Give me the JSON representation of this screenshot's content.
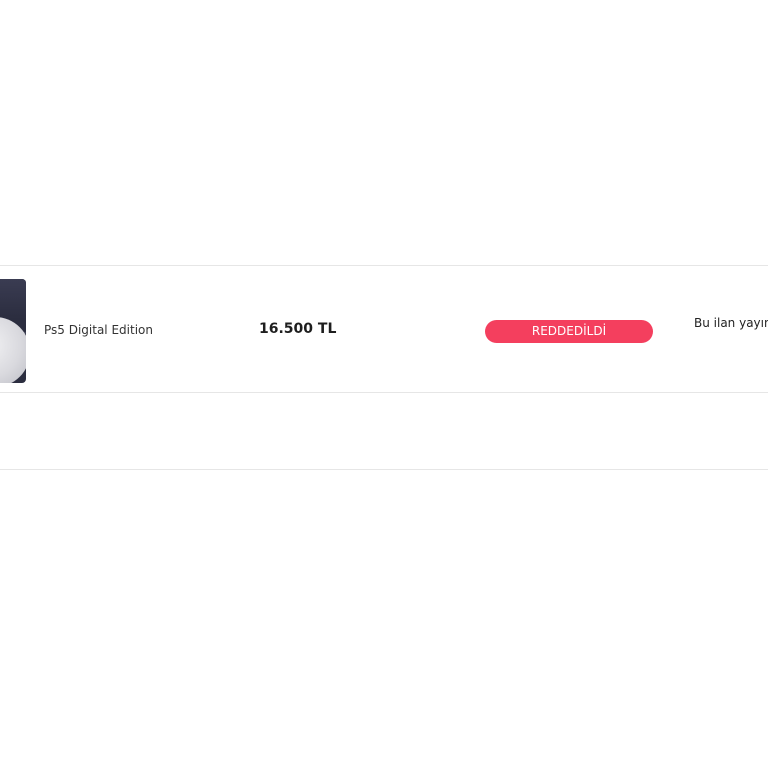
{
  "listing": {
    "title": "Ps5 Digital Edition",
    "price": "16.500 TL",
    "status": "REDDEDİLDİ",
    "note": "Bu ilan yayınla"
  },
  "colors": {
    "status_badge": "#f43f5e",
    "divider": "#e6e6e6"
  }
}
